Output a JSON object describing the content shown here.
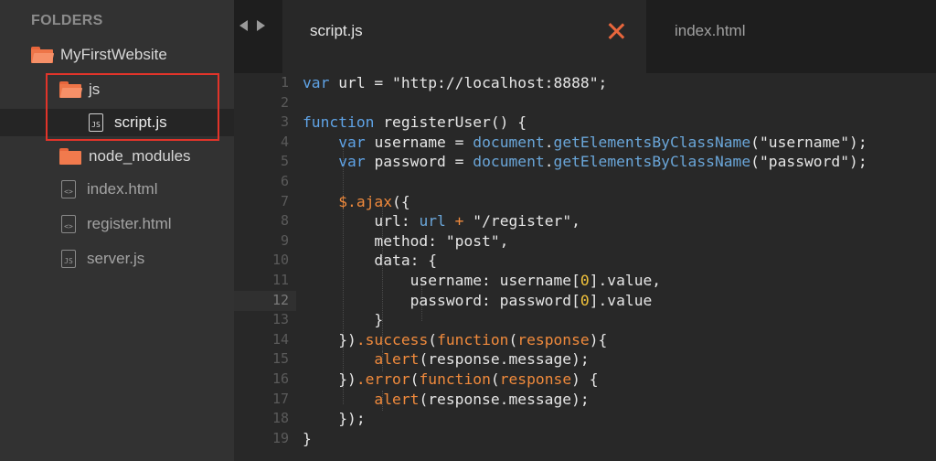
{
  "sidebar": {
    "title": "FOLDERS",
    "items": [
      {
        "label": "MyFirstWebsite",
        "kind": "folder-open"
      },
      {
        "label": "js",
        "kind": "folder-open"
      },
      {
        "label": "script.js",
        "kind": "file-js"
      },
      {
        "label": "node_modules",
        "kind": "folder"
      },
      {
        "label": "index.html",
        "kind": "file-html"
      },
      {
        "label": "register.html",
        "kind": "file-html"
      },
      {
        "label": "server.js",
        "kind": "file-js"
      }
    ],
    "file_icon_js": "JS",
    "file_icon_html": "<>"
  },
  "tabs": [
    {
      "label": "script.js",
      "active": true
    },
    {
      "label": "index.html",
      "active": false
    }
  ],
  "editor": {
    "line_numbers": [
      "1",
      "2",
      "3",
      "4",
      "5",
      "6",
      "7",
      "8",
      "9",
      "10",
      "11",
      "12",
      "13",
      "14",
      "15",
      "16",
      "17",
      "18",
      "19"
    ],
    "current_line": 12
  },
  "colors": {
    "accent": "#e8663c",
    "highlight_box": "#e2342a",
    "keyword": "#5fa3e6"
  }
}
